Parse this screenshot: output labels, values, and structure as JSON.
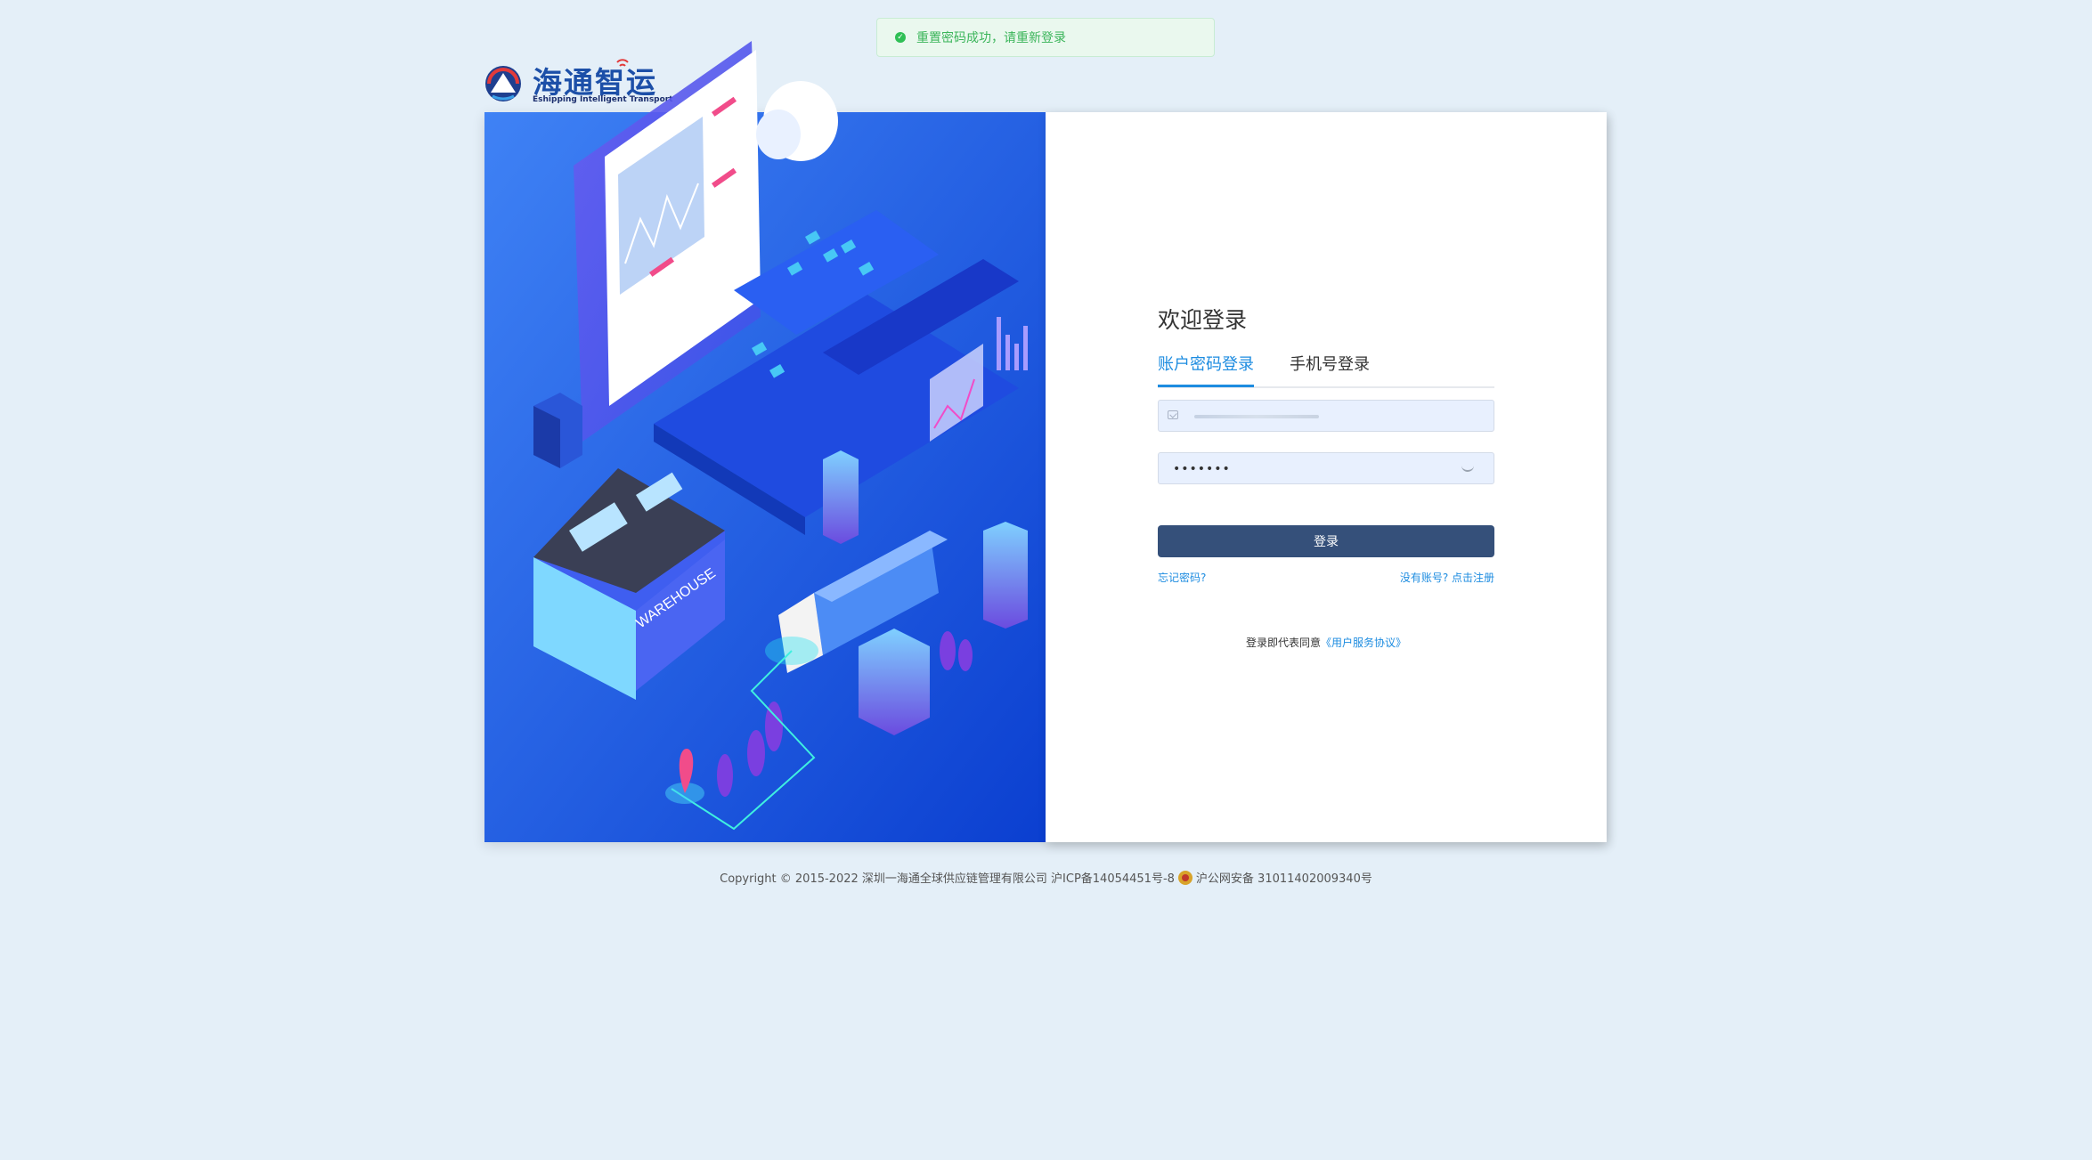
{
  "toast": {
    "message": "重置密码成功，请重新登录",
    "color": "#3bb55a"
  },
  "brand": {
    "name": "海通智运",
    "subtitle": "Eshipping Intelligent Transport"
  },
  "illustration": {
    "warehouse_label": "WAREHOUSE"
  },
  "login": {
    "welcome": "欢迎登录",
    "tabs": [
      {
        "label": "账户密码登录",
        "active": true
      },
      {
        "label": "手机号登录",
        "active": false
      }
    ],
    "username": {
      "value": "",
      "placeholder": ""
    },
    "password": {
      "value": "•••••••"
    },
    "submit_label": "登录",
    "forgot_label": "忘记密码?",
    "register_label": "没有账号? 点击注册",
    "agree_prefix": "登录即代表同意",
    "agree_link": "《用户服务协议》",
    "accent_color": "#1d8ce0",
    "button_color": "#35507a"
  },
  "footer": {
    "copyright": "Copyright © 2015-2022 深圳一海通全球供应链管理有限公司 沪ICP备14054451号-8",
    "police": "沪公网安备 31011402009340号"
  }
}
